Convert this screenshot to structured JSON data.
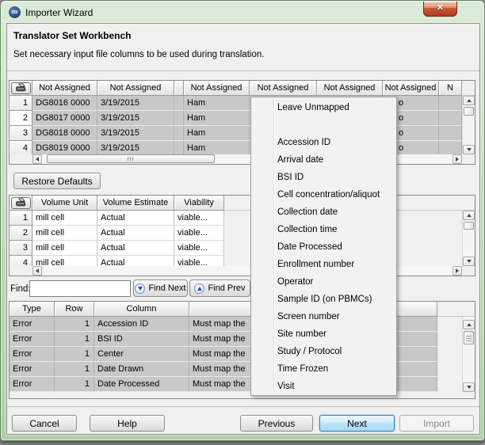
{
  "window": {
    "title": "Importer Wizard",
    "icon_text": "BSI",
    "close_glyph": "✕"
  },
  "header": {
    "title": "Translator Set Workbench",
    "subtitle": "Set necessary input file columns to be used during translation."
  },
  "top_table": {
    "headers": {
      "c1": "Not Assigned",
      "c2": "Not Assigned",
      "c3": "",
      "c4": "Not Assigned",
      "c5": "Not Assigned",
      "c6": "Not Assigned",
      "c7": "Not Assigned",
      "c8": "N"
    },
    "rows": [
      {
        "n": "1",
        "c1": "DG8016 0000",
        "c2": "3/19/2015",
        "c4": "Ham",
        "c7": "o"
      },
      {
        "n": "2",
        "c1": "DG8017 0000",
        "c2": "3/19/2015",
        "c4": "Ham",
        "c7": "o"
      },
      {
        "n": "3",
        "c1": "DG8018 0000",
        "c2": "3/19/2015",
        "c4": "Ham",
        "c7": "o"
      },
      {
        "n": "4",
        "c1": "DG8019 0000",
        "c2": "3/19/2015",
        "c4": "Ham",
        "c7": "o"
      }
    ]
  },
  "middle_table": {
    "headers": {
      "unit": "Volume Unit",
      "estimate": "Volume Estimate",
      "viability": "Viability"
    },
    "rows": [
      {
        "n": "1",
        "unit": "mill cell",
        "estimate": "Actual",
        "viability": "viable..."
      },
      {
        "n": "2",
        "unit": "mill cell",
        "estimate": "Actual",
        "viability": "viable..."
      },
      {
        "n": "3",
        "unit": "mill cell",
        "estimate": "Actual",
        "viability": "viable..."
      },
      {
        "n": "4",
        "unit": "mill cell",
        "estimate": "Actual",
        "viability": "viable..."
      }
    ]
  },
  "find": {
    "label": "Find:",
    "value": "",
    "next_label": "Find Next",
    "prev_label": "Find Prev"
  },
  "bottom_table": {
    "headers": {
      "type": "Type",
      "row": "Row",
      "column": "Column",
      "message": ""
    },
    "rows": [
      {
        "type": "Error",
        "row": "1",
        "column": "Accession ID",
        "message": "Must map the"
      },
      {
        "type": "Error",
        "row": "1",
        "column": "BSI ID",
        "message": "Must map the"
      },
      {
        "type": "Error",
        "row": "1",
        "column": "Center",
        "message": "Must map the"
      },
      {
        "type": "Error",
        "row": "1",
        "column": "Date Drawn",
        "message": "Must map the"
      },
      {
        "type": "Error",
        "row": "1",
        "column": "Date Processed",
        "message": "Must map the"
      }
    ]
  },
  "menu": {
    "top_item": "Leave Unmapped",
    "items": [
      "Accession ID",
      "Arrival date",
      "BSI ID",
      "Cell concentration/aliquot",
      "Collection date",
      "Collection time",
      "Date Processed",
      "Enrollment number",
      "Operator",
      "Sample ID (on PBMCs)",
      "Screen number",
      "Site number",
      "Study / Protocol",
      "Time Frozen",
      "Visit"
    ]
  },
  "buttons": {
    "restore": "Restore Defaults",
    "cancel": "Cancel",
    "help": "Help",
    "previous": "Previous",
    "next": "Next",
    "import": "Import"
  },
  "colors": {
    "titlebar_green": "#c6dcc1",
    "close_red": "#c14f33",
    "selection_gray": "#c8c8c8",
    "default_button_accent": "#3c7fb1"
  }
}
